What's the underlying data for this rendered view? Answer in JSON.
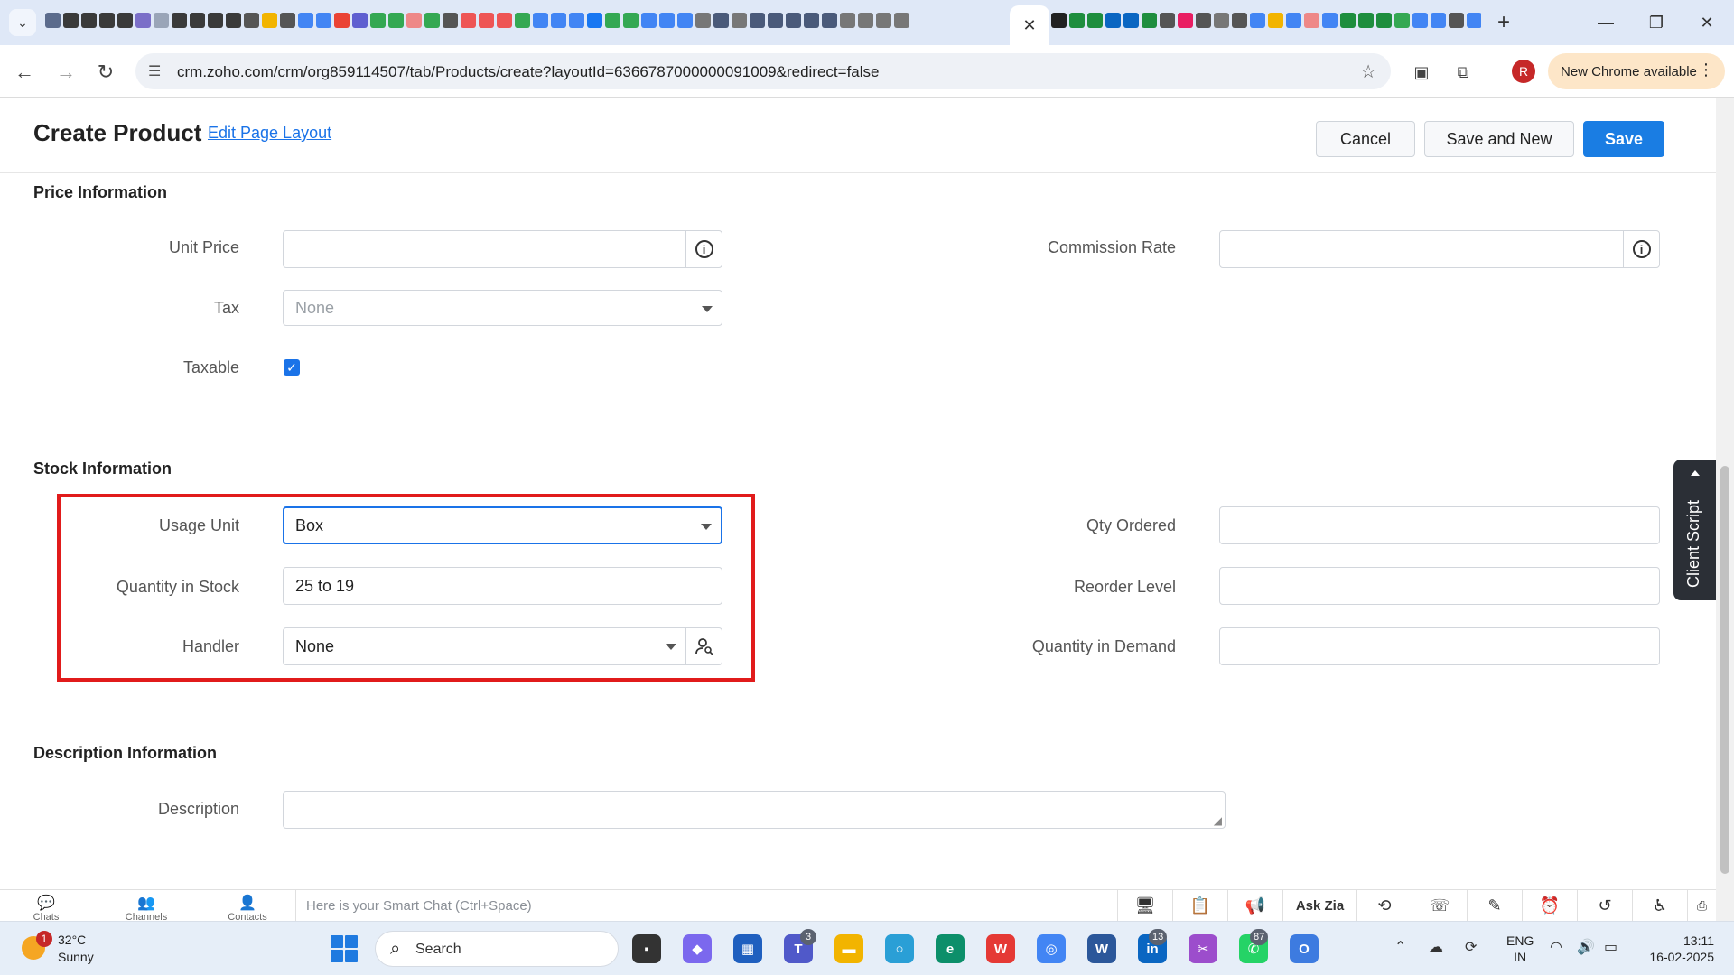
{
  "browser": {
    "address_url": "crm.zoho.com/crm/org859114507/tab/Products/create?layoutId=6366787000000091009&redirect=false",
    "update_label": "New Chrome available",
    "profile_initial": "R"
  },
  "page": {
    "title": "Create Product",
    "edit_layout_link": "Edit Page Layout",
    "buttons": {
      "cancel": "Cancel",
      "save_and_new": "Save and New",
      "save": "Save"
    }
  },
  "price_section": {
    "title": "Price Information",
    "unit_price": {
      "label": "Unit Price",
      "value": ""
    },
    "commission_rate": {
      "label": "Commission Rate",
      "value": ""
    },
    "tax": {
      "label": "Tax",
      "placeholder": "None"
    },
    "taxable": {
      "label": "Taxable",
      "checked": true
    }
  },
  "stock_section": {
    "title": "Stock Information",
    "usage_unit": {
      "label": "Usage Unit",
      "value": "Box"
    },
    "quantity_in_stock": {
      "label": "Quantity in Stock",
      "value": "25 to 19"
    },
    "handler": {
      "label": "Handler",
      "value": "None"
    },
    "qty_ordered": {
      "label": "Qty Ordered",
      "value": ""
    },
    "reorder_level": {
      "label": "Reorder Level",
      "value": ""
    },
    "quantity_in_demand": {
      "label": "Quantity in Demand",
      "value": ""
    }
  },
  "description_section": {
    "title": "Description Information",
    "description": {
      "label": "Description",
      "value": ""
    }
  },
  "client_script": "Client Script",
  "zoho_bar": {
    "chats": "Chats",
    "channels": "Channels",
    "contacts": "Contacts",
    "smart_chat_placeholder": "Here is your Smart Chat (Ctrl+Space)",
    "ask_zia": "Ask Zia"
  },
  "taskbar": {
    "weather_temp": "32°C",
    "weather_cond": "Sunny",
    "weather_badge": "1",
    "search_label": "Search",
    "teams_badge": "3",
    "linkedin_badge": "13",
    "whatsapp_badge": "87",
    "lang_top": "ENG",
    "lang_bottom": "IN",
    "time": "13:11",
    "date": "16-02-2025"
  },
  "colors": {
    "accent": "#1a7de3",
    "highlight": "#e11b1b",
    "tabstrip": "#dfe8f7"
  }
}
